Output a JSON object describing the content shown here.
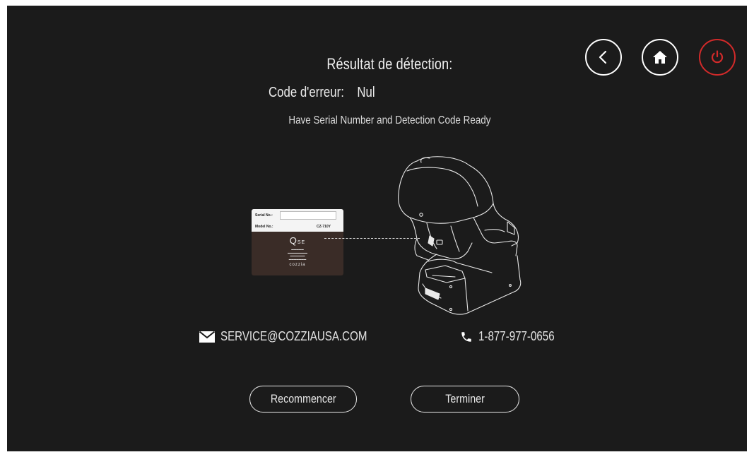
{
  "header": {
    "title": "Résultat de détection:",
    "error_label": "Code d'erreur:",
    "error_value": "Nul",
    "hint": "Have Serial Number and Detection Code Ready"
  },
  "nav": {
    "back_icon": "chevron-left-icon",
    "home_icon": "home-icon",
    "power_icon": "power-icon",
    "power_color": "#d22a2a"
  },
  "label": {
    "serial_label": "Serial No.:",
    "model_label": "Model No.:",
    "model_value": "CZ-710Y",
    "logo": "Q",
    "logo_suffix": "SE",
    "brand": "cozzia"
  },
  "contact": {
    "email": "SERVICE@COZZIAUSA.COM",
    "phone": "1-877-977-0656",
    "email_icon": "envelope-icon",
    "phone_icon": "phone-icon"
  },
  "actions": {
    "restart_label": "Recommencer",
    "finish_label": "Terminer"
  }
}
